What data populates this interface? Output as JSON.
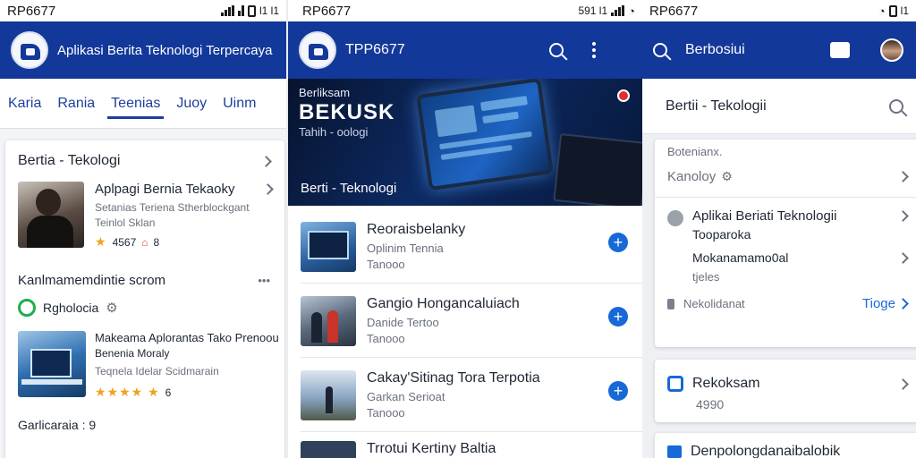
{
  "screen1": {
    "status_time": "RP6677",
    "status_right": "l1 l1",
    "app_title": "Aplikasi Berita Teknologi Terpercaya",
    "tabs": [
      "Karia",
      "Rania",
      "Teenias",
      "Juoy",
      "Uinm"
    ],
    "section_header": "Bertia - Tekologi",
    "article1": {
      "title": "Aplpagi Bernia Tekaoky",
      "subtitle": "Setanias Teriena Stherblockgant",
      "meta": "Teinlol Sklan",
      "rating": "4567",
      "extra": "8"
    },
    "section2_header": "Kanlmamemdintie scrom",
    "section2_more": "•••",
    "section2_chip": "Rgholocia",
    "article2": {
      "title": "Makeama Aplorantas Tako Prenoou",
      "subtitle": "Benenia Moraly",
      "meta": "Teqnela Idelar Scidmarain",
      "extra": "6"
    },
    "footer_item": "Garlicaraia : 9"
  },
  "screen2": {
    "status_time": "RP6677",
    "status_right": "591 l1",
    "app_title": "TPP6677",
    "hero": {
      "line1": "Berliksam",
      "line2": "BEKUSK",
      "line3": "Tahih - oologi",
      "caption": "Berti - Teknologi"
    },
    "items": [
      {
        "title": "Reoraisbelanky",
        "subtitle": "Oplinim Tennia",
        "meta": "Tanooo"
      },
      {
        "title": "Gangio Hongancaluiach",
        "subtitle": "Danide Tertoo",
        "meta": "Tanooo"
      },
      {
        "title": "Cakay'Sitinag Tora Terpotia",
        "subtitle": "Garkan Serioat",
        "meta": "Tanooo"
      },
      {
        "title": "Trrotui Kertiny Baltia",
        "subtitle": "",
        "meta": ""
      }
    ]
  },
  "screen3": {
    "status_time": "RP6677",
    "status_right": "l1",
    "app_title": "Berbosiui",
    "search_header": "Bertii - Tekologii",
    "card1_label": "Botenianx.",
    "card1_value": "Kanoloy",
    "card1_item_title": "Aplikai Beriati Teknologii",
    "card1_item_sub": "Tooparoka",
    "card1_item2_title": "Mokanamamo0al",
    "card1_item2_sub": "tjeles",
    "card1_footer": "Nekolidanat",
    "card1_link": "Tioge",
    "card2_title": "Rekoksam",
    "card2_value": "4990",
    "card3_title": "Denpolongdanaibalobik"
  },
  "colors": {
    "primary": "#12389a",
    "accent": "#1669d6",
    "star": "#f0a21c"
  }
}
